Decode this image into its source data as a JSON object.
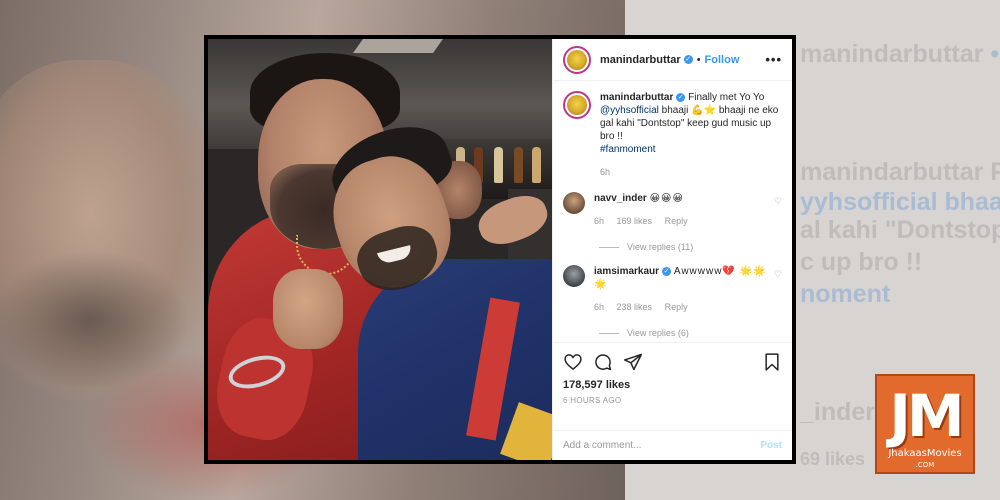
{
  "background": {
    "r_line1": "manindarbuttar",
    "r_follow": "• Follo",
    "r_line2": "manindarbuttar Finall",
    "r_line3": "yyhsofficial bhaaji 💪⭐",
    "r_line4": "al kahi \"Dontstop\" k",
    "r_line5": "c up bro !!",
    "r_line6": "noment",
    "r_line7": "_inder",
    "r_line8": "69 likes"
  },
  "post": {
    "username": "manindarbuttar",
    "verified_mark": "✓",
    "separator": "•",
    "follow_label": "Follow",
    "more_label": "•••",
    "caption": {
      "username": "manindarbuttar",
      "text1": "Finally met Yo Yo",
      "mention": "@yyhsofficial",
      "text2": "bhaaji 💪⭐ bhaaji ne eko gal kahi \"Dontstop\" keep gud music up bro !!",
      "hashtag": "#fanmoment",
      "age": "6h"
    },
    "comments": [
      {
        "username": "navv_inder",
        "text": "😀😀😀",
        "age": "6h",
        "likes": "169 likes",
        "reply_label": "Reply",
        "view_replies": "View replies (11)"
      },
      {
        "username": "iamsimarkaur",
        "text": "Awwwww💔 🌟🌟🌟",
        "age": "6h",
        "likes": "238 likes",
        "reply_label": "Reply",
        "view_replies": "View replies (6)"
      }
    ],
    "likes_count": "178,597 likes",
    "posted": "6 HOURS AGO",
    "add_comment_placeholder": "Add a comment...",
    "post_label": "Post",
    "icons": [
      "heart-icon",
      "comment-icon",
      "share-icon",
      "bookmark-icon"
    ]
  },
  "watermark": {
    "letters": "JM",
    "name": "JhakaasMovies",
    "domain": ".COM"
  },
  "colors": {
    "link": "#3897f0",
    "logo": "#e26a2c"
  }
}
